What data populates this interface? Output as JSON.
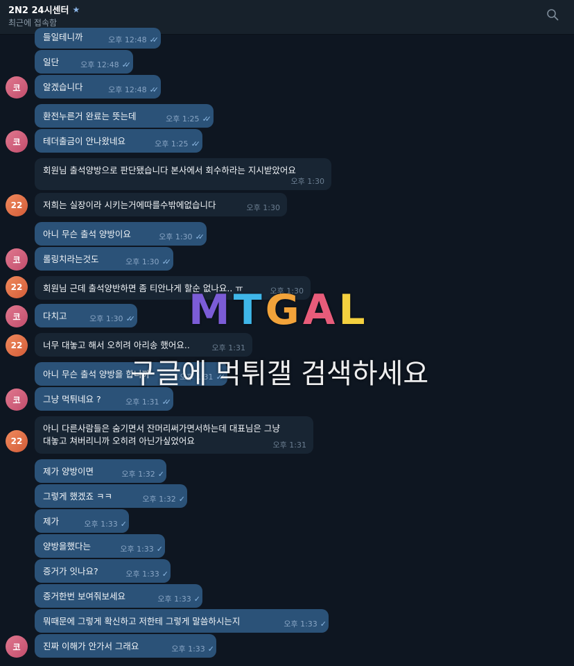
{
  "header": {
    "title": "2N2 24시센터",
    "subtitle": "최근에 접속함"
  },
  "messages": [
    {
      "text": "들일테니까",
      "time": "오후 12:48"
    },
    {
      "text": "일단",
      "time": "오후 12:48"
    },
    {
      "text": "알겠습니다",
      "time": "오후 12:48",
      "avatar": "코"
    },
    {
      "text": "환전누른거 완료는 뜻는데",
      "time": "오후 1:25"
    },
    {
      "text": "테더출금이 안나왔네요",
      "time": "오후 1:25",
      "avatar": "코"
    },
    {
      "text": "회원님 출석양방으로 판단됐습니다 본사에서 회수하라는 지시받았어요",
      "time": "오후 1:30"
    },
    {
      "text": "저희는 실장이라 시키는거에따를수밖에없습니다",
      "time": "오후 1:30",
      "avatar": "22"
    },
    {
      "text": "아니 무슨 출석 양방이요",
      "time": "오후 1:30"
    },
    {
      "text": "롤링치라는것도",
      "time": "오후 1:30",
      "avatar": "코"
    },
    {
      "text": "회원님 근데 출석양반하면 좀 티안나게 할순 없나요.. ㅠ",
      "time": "오후 1:30",
      "avatar": "22"
    },
    {
      "text": "다치고",
      "time": "오후 1:30",
      "avatar": "코"
    },
    {
      "text": "너무 대놓고 해서 오히려 아리송 했어요..",
      "time": "오후 1:31",
      "avatar": "22"
    },
    {
      "text": "아니 무슨 출석 양방을 합니까",
      "time": "오후 1:31"
    },
    {
      "text": "그냥 먹튀네요 ?",
      "time": "오후 1:31",
      "avatar": "코"
    },
    {
      "text": "아니 다른사람들은 숨기면서 잔머리써가면서하는데 대표님은 그냥",
      "text2": "대놓고 쳐버리니까 오히려 아닌가싶었어요",
      "time": "오후 1:31",
      "avatar": "22"
    },
    {
      "text": "제가 양방이면",
      "time": "오후 1:32"
    },
    {
      "text": "그렇게 했겠죠 ㅋㅋ",
      "time": "오후 1:32"
    },
    {
      "text": "제가",
      "time": "오후 1:33"
    },
    {
      "text": "양방을했다는",
      "time": "오후 1:33"
    },
    {
      "text": "증거가 잇나요?",
      "time": "오후 1:33"
    },
    {
      "text": "증거한번 보여줘보세요",
      "time": "오후 1:33"
    },
    {
      "text": "뭐때문에 그렇게 확신하고 저한테 그렇게 말씀하시는지",
      "time": "오후 1:33"
    },
    {
      "text": "진짜 이해가 안가서 그래요",
      "time": "오후 1:33",
      "avatar": "코"
    }
  ],
  "watermark": {
    "logo": [
      "M",
      "T",
      "G",
      "A",
      "L"
    ],
    "logo_colors": [
      "#7b5cd6",
      "#3fb6e8",
      "#f2a33a",
      "#e85c7a",
      "#f4d03f"
    ],
    "text": "구글에 먹튀갤 검색하세요"
  },
  "colors": {
    "background": "#0e1621",
    "outgoing_bubble": "#2b5278",
    "incoming_bubble": "#182533",
    "header": "#17212b"
  }
}
